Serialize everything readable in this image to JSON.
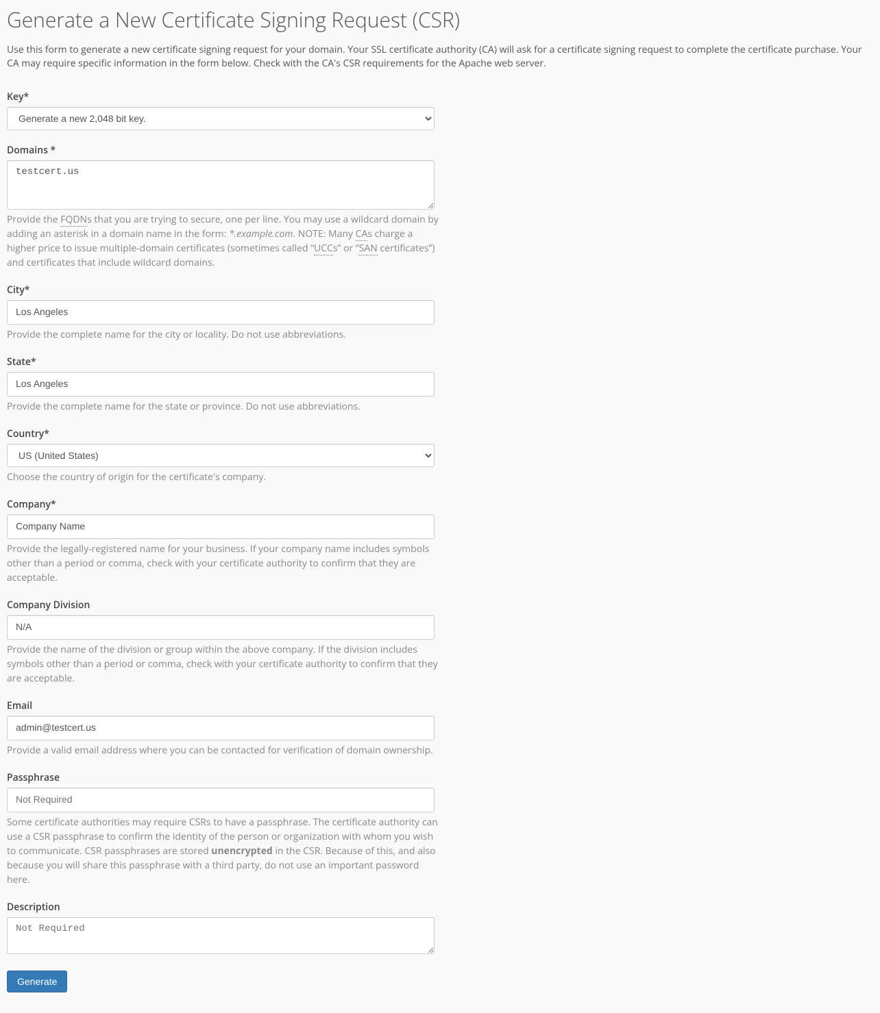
{
  "page": {
    "title": "Generate a New Certificate Signing Request (CSR)",
    "intro": "Use this form to generate a new certificate signing request for your domain. Your SSL certificate authority (CA) will ask for a certificate signing request to complete the certificate purchase. Your CA may require specific information in the form below. Check with the CA's CSR requirements for the Apache web server."
  },
  "fields": {
    "key": {
      "label": "Key*",
      "selected": "Generate a new 2,048 bit key."
    },
    "domains": {
      "label": "Domains *",
      "value": "testcert.us",
      "help_pre": "Provide the ",
      "help_abbr1": "FQDN",
      "help_mid1": "s that you are trying to secure, one per line. You may use a wildcard domain by adding an asterisk in a domain name in the form: ",
      "help_italic": "*.example.com",
      "help_mid2": ". NOTE: Many ",
      "help_abbr2": "CA",
      "help_mid3": "s charge a higher price to issue multiple-domain certificates (sometimes called “",
      "help_abbr3": "UCC",
      "help_mid4": "s” or “",
      "help_abbr4": "SAN",
      "help_post": " certificates”) and certificates that include wildcard domains."
    },
    "city": {
      "label": "City*",
      "value": "Los Angeles",
      "help": "Provide the complete name for the city or locality. Do not use abbreviations."
    },
    "state": {
      "label": "State*",
      "value": "Los Angeles",
      "help": "Provide the complete name for the state or province. Do not use abbreviations."
    },
    "country": {
      "label": "Country*",
      "selected": "US (United States)",
      "help": "Choose the country of origin for the certificate's company."
    },
    "company": {
      "label": "Company*",
      "value": "Company Name",
      "help": "Provide the legally-registered name for your business. If your company name includes symbols other than a period or comma, check with your certificate authority to confirm that they are acceptable."
    },
    "division": {
      "label": "Company Division",
      "value": "N/A",
      "help": "Provide the name of the division or group within the above company. If the division includes symbols other than a period or comma, check with your certificate authority to confirm that they are acceptable."
    },
    "email": {
      "label": "Email",
      "value": "admin@testcert.us",
      "help": "Provide a valid email address where you can be contacted for verification of domain ownership."
    },
    "passphrase": {
      "label": "Passphrase",
      "placeholder": "Not Required",
      "help_pre": "Some certificate authorities may require CSRs to have a passphrase. The certificate authority can use a CSR passphrase to confirm the identity of the person or organization with whom you wish to communicate. CSR passphrases are stored ",
      "help_strong": "unencrypted",
      "help_post": " in the CSR. Because of this, and also because you will share this passphrase with a third party, do not use an important password here."
    },
    "description": {
      "label": "Description",
      "placeholder": "Not Required"
    }
  },
  "actions": {
    "generate": "Generate"
  }
}
